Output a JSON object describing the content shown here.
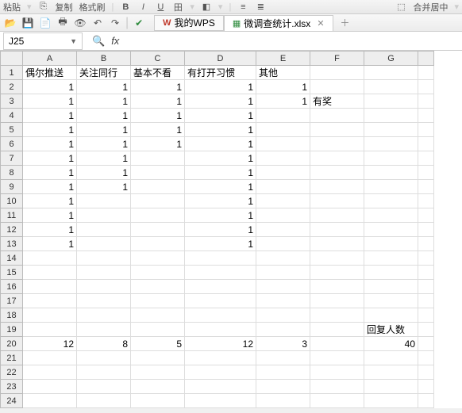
{
  "toolbar1": {
    "paste": "粘贴",
    "copy": "复制",
    "fmtbrush": "格式刷",
    "merge": "合并居中"
  },
  "tabs": {
    "t1": "我的WPS",
    "t2": "微调查统计.xlsx"
  },
  "namebox": {
    "value": "J25"
  },
  "fx": {
    "label": "fx"
  },
  "columns": [
    "A",
    "B",
    "C",
    "D",
    "E",
    "F",
    "G"
  ],
  "rows": [
    "1",
    "2",
    "3",
    "4",
    "5",
    "6",
    "7",
    "8",
    "9",
    "10",
    "11",
    "12",
    "13",
    "14",
    "15",
    "16",
    "17",
    "18",
    "19",
    "20",
    "21",
    "22",
    "23",
    "24"
  ],
  "grid": {
    "r1": {
      "A": "偶尔推送",
      "B": "关注同行",
      "C": "基本不看",
      "D": "有打开习惯",
      "E": "其他"
    },
    "r2": {
      "A": "1",
      "B": "1",
      "C": "1",
      "D": "1",
      "E": "1"
    },
    "r3": {
      "A": "1",
      "B": "1",
      "C": "1",
      "D": "1",
      "E": "1",
      "F": "有奖"
    },
    "r4": {
      "A": "1",
      "B": "1",
      "C": "1",
      "D": "1"
    },
    "r5": {
      "A": "1",
      "B": "1",
      "C": "1",
      "D": "1"
    },
    "r6": {
      "A": "1",
      "B": "1",
      "C": "1",
      "D": "1"
    },
    "r7": {
      "A": "1",
      "B": "1",
      "D": "1"
    },
    "r8": {
      "A": "1",
      "B": "1",
      "D": "1"
    },
    "r9": {
      "A": "1",
      "B": "1",
      "D": "1"
    },
    "r10": {
      "A": "1",
      "D": "1"
    },
    "r11": {
      "A": "1",
      "D": "1"
    },
    "r12": {
      "A": "1",
      "D": "1"
    },
    "r13": {
      "A": "1",
      "D": "1"
    },
    "r19": {
      "G": "回复人数"
    },
    "r20": {
      "A": "12",
      "B": "8",
      "C": "5",
      "D": "12",
      "E": "3",
      "G": "40"
    }
  }
}
